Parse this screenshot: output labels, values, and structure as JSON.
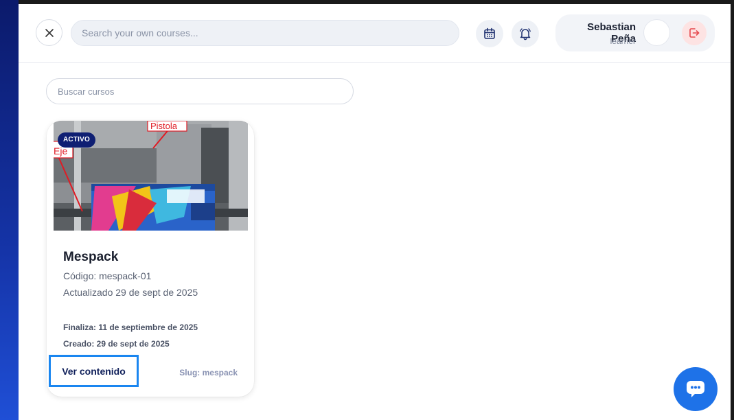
{
  "header": {
    "search_placeholder": "Search your own courses...",
    "user": {
      "name": "Sebastian Peña",
      "role": "learner"
    }
  },
  "main": {
    "search_placeholder": "Buscar cursos",
    "courses": [
      {
        "status": "ACTIVO",
        "image_labels": {
          "top": "Pistola",
          "left": "Eje"
        },
        "title": "Mespack",
        "code": "Código: mespack-01",
        "updated": "Actualizado 29 de sept de 2025",
        "ends": "Finaliza: 11 de septiembre de 2025",
        "created": "Creado: 29 de sept de 2025",
        "view_label": "Ver contenido",
        "slug": "Slug: mespack"
      }
    ]
  },
  "icons": {
    "close": "close-icon",
    "calendar": "calendar-icon",
    "bell": "bell-icon",
    "logout": "logout-icon",
    "chat": "chat-icon"
  },
  "colors": {
    "accent": "#1e72e8",
    "badge": "#0f1f73",
    "logout_bg": "#fde3e3",
    "highlight_border": "#1a86f0"
  }
}
